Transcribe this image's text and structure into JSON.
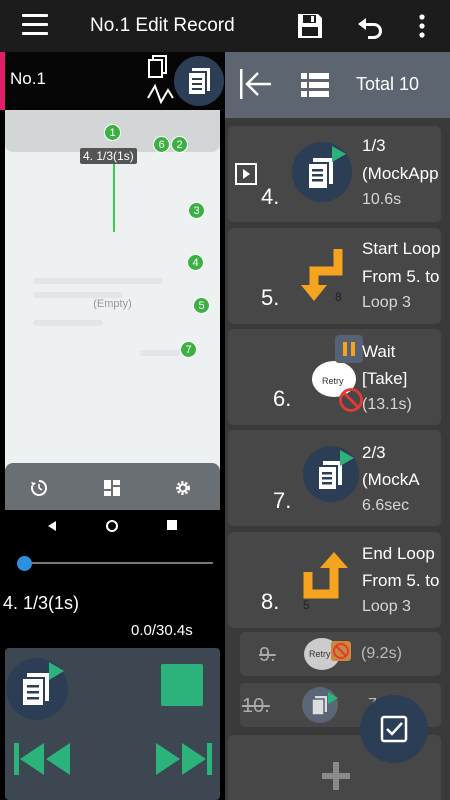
{
  "appbar": {
    "title": "No.1 Edit Record"
  },
  "left": {
    "record_label": "No.1",
    "preview": {
      "empty_text": "(Empty)",
      "step_overlay": "4. 1/3(1s)",
      "markers": [
        "1",
        "6",
        "2",
        "3",
        "4",
        "5",
        "7"
      ]
    },
    "step_text": "4. 1/3(1s)",
    "time_text": "0.0/30.4s",
    "progress": 0.0
  },
  "right": {
    "total_label": "Total 10",
    "items": [
      {
        "num": "4.",
        "line1": "1/3",
        "line2": "(MockApp",
        "line3": "10.6s",
        "type": "tap"
      },
      {
        "num": "5.",
        "line1": "Start Loop",
        "line2": "From 5. to",
        "line3": "Loop 3",
        "sub": "8",
        "type": "loop-start"
      },
      {
        "num": "6.",
        "line1": "Wait",
        "line2": "[Take]",
        "line3": "(13.1s)",
        "retry": "Retry",
        "type": "wait"
      },
      {
        "num": "7.",
        "line1": "2/3",
        "line2": "(MockA",
        "line3": "6.6sec",
        "type": "tap"
      },
      {
        "num": "8.",
        "line1": "End Loop",
        "line2": "From 5. to",
        "line3": "Loop 3",
        "sub": "5",
        "type": "loop-end"
      },
      {
        "num": "9.",
        "retry": "Retry",
        "detail": "(9.2s)",
        "type": "disabled"
      },
      {
        "num": "10.",
        "detail": "7.6",
        "type": "disabled"
      }
    ]
  },
  "colors": {
    "accent": "#2bb37b",
    "pink": "#e21d6b",
    "orange": "#f6a41f",
    "marker_green": "#3cb043",
    "navy": "#2c3e55"
  }
}
